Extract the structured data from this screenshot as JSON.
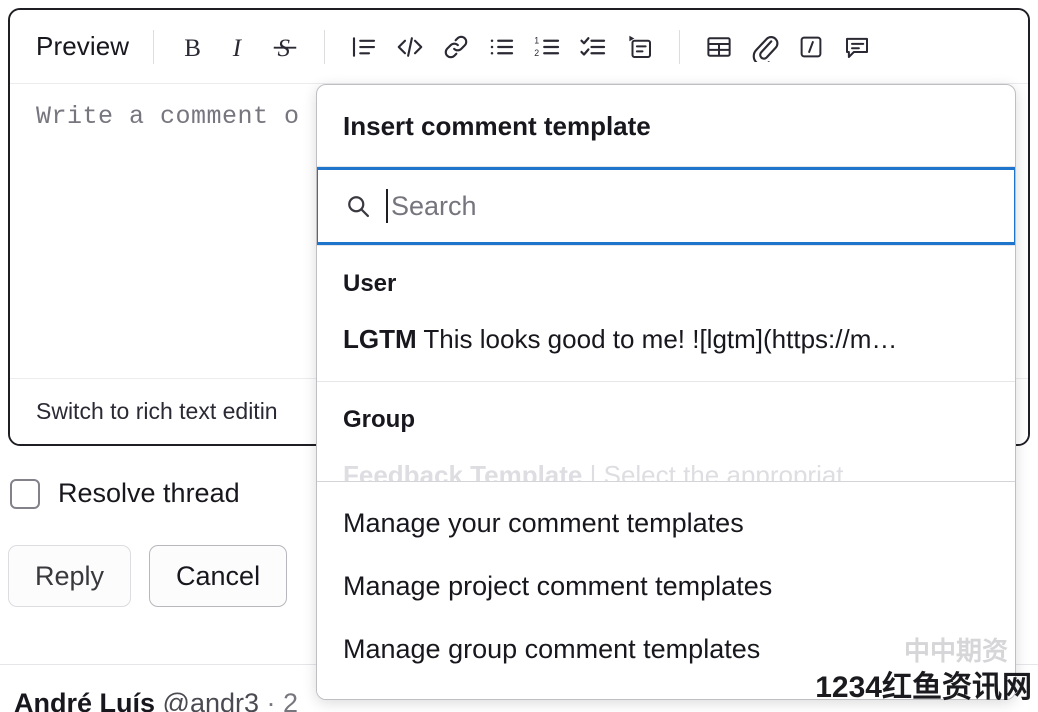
{
  "editor": {
    "toolbar": {
      "preview_label": "Preview",
      "buttons": [
        {
          "name": "bold-icon",
          "title": "Bold"
        },
        {
          "name": "italic-icon",
          "title": "Italic"
        },
        {
          "name": "strikethrough-icon",
          "title": "Strikethrough"
        },
        {
          "name": "quote-icon",
          "title": "Insert a quote"
        },
        {
          "name": "code-icon",
          "title": "Insert code"
        },
        {
          "name": "link-icon",
          "title": "Insert a link"
        },
        {
          "name": "bulleted-list-icon",
          "title": "Add a bullet list"
        },
        {
          "name": "numbered-list-icon",
          "title": "Add a numbered list"
        },
        {
          "name": "checklist-icon",
          "title": "Add a checklist"
        },
        {
          "name": "collapsible-section-icon",
          "title": "Add a collapsible section"
        },
        {
          "name": "table-icon",
          "title": "Insert table"
        },
        {
          "name": "attachment-icon",
          "title": "Attach a file or image"
        },
        {
          "name": "slash-command-icon",
          "title": "Insert a quick action"
        },
        {
          "name": "comment-template-icon",
          "title": "Insert comment template"
        }
      ]
    },
    "textarea_placeholder": "Write a comment o",
    "switch_link_label": "Switch to rich text editin"
  },
  "controls": {
    "resolve_label": "Resolve thread",
    "resolve_checked": false,
    "reply_label": "Reply",
    "cancel_label": "Cancel"
  },
  "thread": {
    "author_name": "André Luís",
    "author_handle": "@andr3",
    "separator": "·",
    "timestamp": "2"
  },
  "dropdown": {
    "title": "Insert comment template",
    "search": {
      "placeholder": "Search",
      "value": "",
      "icon": "search-icon",
      "focused": true,
      "focus_color": "#1f75cb"
    },
    "sections": [
      {
        "label": "User",
        "items": [
          {
            "name": "LGTM",
            "description": "This looks good to me! ![lgtm](https://m…",
            "faded": false
          }
        ]
      },
      {
        "label": "Group",
        "items": [
          {
            "name": "Feedback Template",
            "description": "| Select the appropriat",
            "faded": true
          }
        ]
      }
    ],
    "footer_items": [
      "Manage your comment templates",
      "Manage project comment templates",
      "Manage group comment templates"
    ]
  },
  "watermark": {
    "text": "1234红鱼资讯网",
    "ghost_text": "中中期资"
  }
}
